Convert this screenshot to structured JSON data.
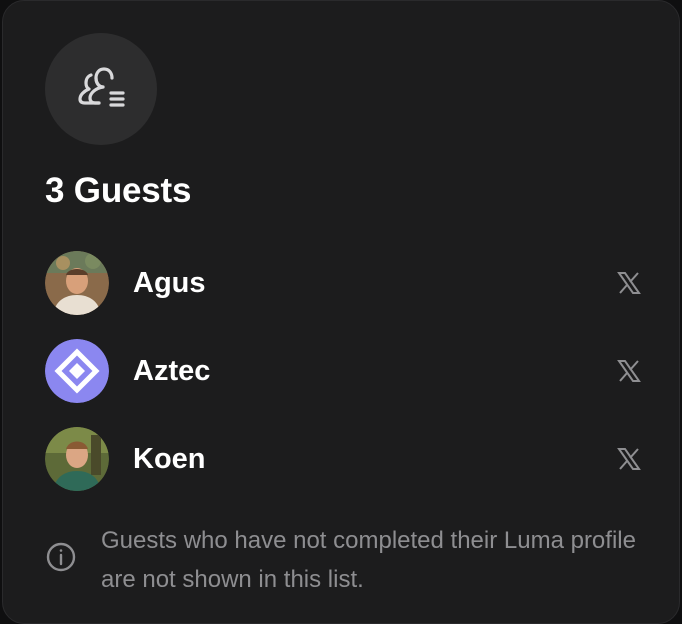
{
  "dialog": {
    "icon": "guest-list-icon",
    "title": "3 Guests"
  },
  "guests": [
    {
      "name": "Agus",
      "avatar": "photo-avatar",
      "social_icon": "x-twitter-icon"
    },
    {
      "name": "Aztec",
      "avatar": "aztec-logo-avatar",
      "social_icon": "x-twitter-icon"
    },
    {
      "name": "Koen",
      "avatar": "photo-avatar",
      "social_icon": "x-twitter-icon"
    }
  ],
  "footer": {
    "icon": "info-icon",
    "note": "Guests who have not completed their Luma profile are not shown in this list."
  },
  "colors": {
    "modal_bg": "#1c1c1d",
    "icon_circle_bg": "#2d2d2e",
    "text_primary": "#ffffff",
    "text_muted": "#8e8e91",
    "aztec_purple": "#8b87f0"
  }
}
